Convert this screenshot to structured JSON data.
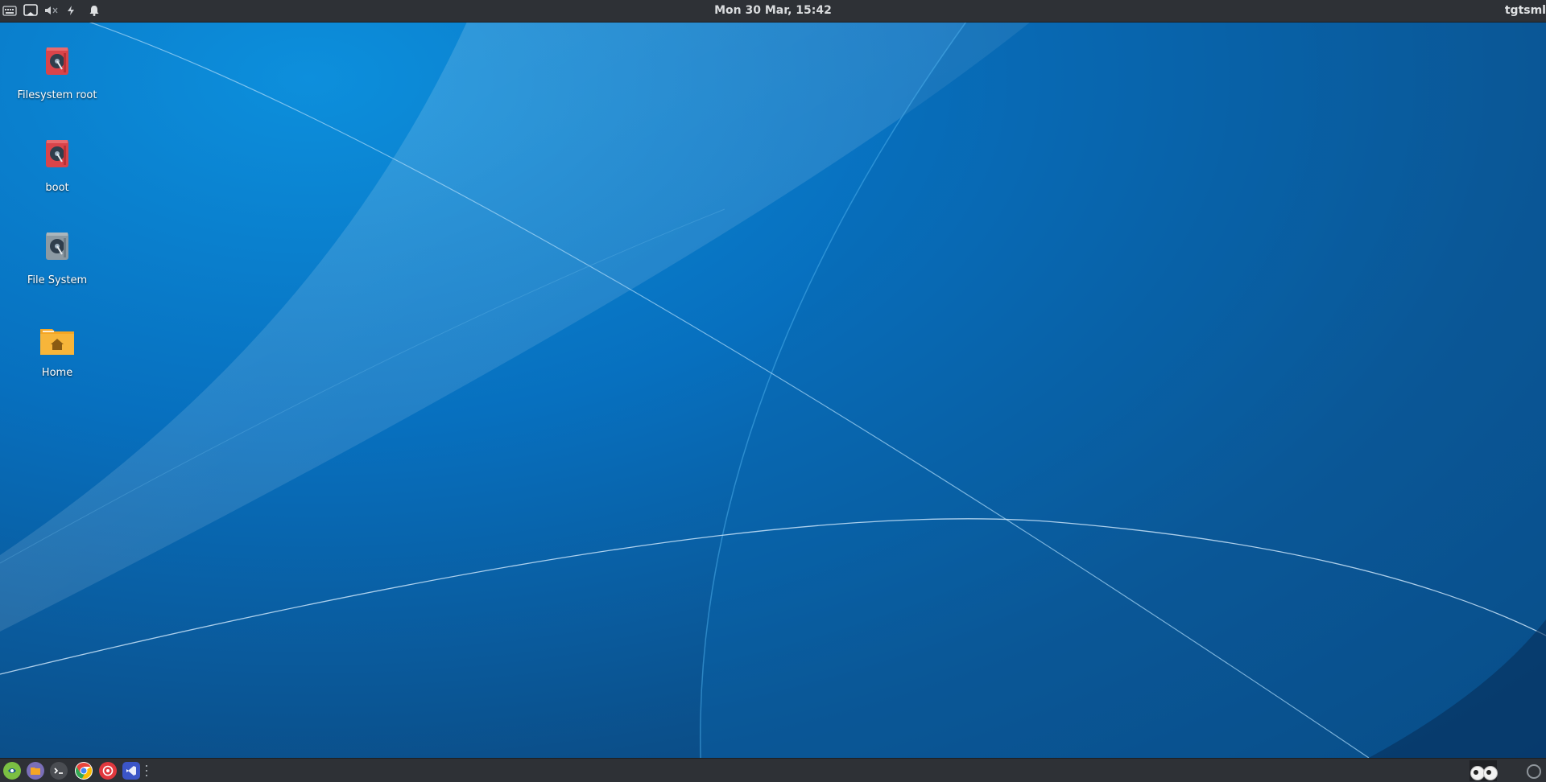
{
  "top_panel": {
    "icons": [
      "keyboard-icon",
      "window-list-icon",
      "volume-muted-icon",
      "power-icon",
      "bell-icon"
    ],
    "clock": "Mon 30 Mar, 15:42",
    "user": "tgtsml"
  },
  "desktop": {
    "icons": [
      {
        "label": "Filesystem root",
        "icon": "drive-red-icon"
      },
      {
        "label": "boot",
        "icon": "drive-red-icon"
      },
      {
        "label": "File System",
        "icon": "drive-grey-icon"
      },
      {
        "label": "Home",
        "icon": "home-folder-icon"
      }
    ]
  },
  "bottom_panel": {
    "launchers": [
      {
        "name": "menu",
        "icon": "app-menu-icon",
        "color": "#7bc043"
      },
      {
        "name": "files",
        "icon": "file-manager-icon",
        "color": "#7a6fb8"
      },
      {
        "name": "terminal",
        "icon": "terminal-icon",
        "color": "#4a4d52"
      },
      {
        "name": "chrome",
        "icon": "chrome-icon",
        "color": "#e8453c"
      },
      {
        "name": "screenshot",
        "icon": "screenshot-tool-icon",
        "color": "#e0383e"
      },
      {
        "name": "vscode",
        "icon": "vscode-icon",
        "color": "#3b55c7"
      }
    ],
    "tray": [
      "eyes-icon",
      "power-status-icon"
    ]
  },
  "colors": {
    "panel_bg": "#2e3136",
    "wallpaper_primary": "#0770bf",
    "folder_orange": "#f5a623",
    "drive_red": "#d9444a"
  }
}
